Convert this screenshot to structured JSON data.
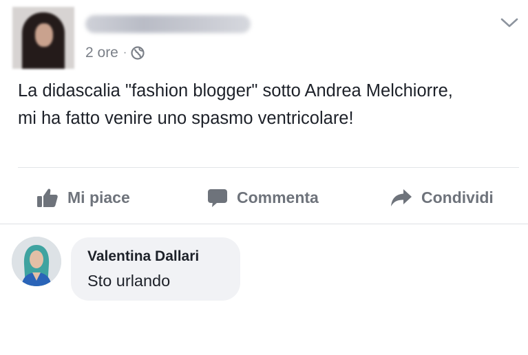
{
  "post": {
    "author_name": "",
    "time": "2 ore",
    "meta_separator": "·",
    "audience_icon": "globe-icon",
    "menu_icon": "chevron-down-icon",
    "text": "La didascalia \"fashion blogger\" sotto Andrea Melchiorre, mi ha fatto venire uno spasmo ventricolare!"
  },
  "actions": {
    "like": {
      "label": "Mi piace",
      "icon": "like-icon"
    },
    "comment": {
      "label": "Commenta",
      "icon": "comment-icon"
    },
    "share": {
      "label": "Condividi",
      "icon": "share-icon"
    }
  },
  "comment": {
    "author": "Valentina Dallari",
    "text": "Sto urlando"
  },
  "colors": {
    "text_primary": "#1d2129",
    "text_secondary": "#7b8088",
    "action_gray": "#6e737b",
    "bubble_bg": "#f1f2f5",
    "divider": "#e2e4e8"
  }
}
